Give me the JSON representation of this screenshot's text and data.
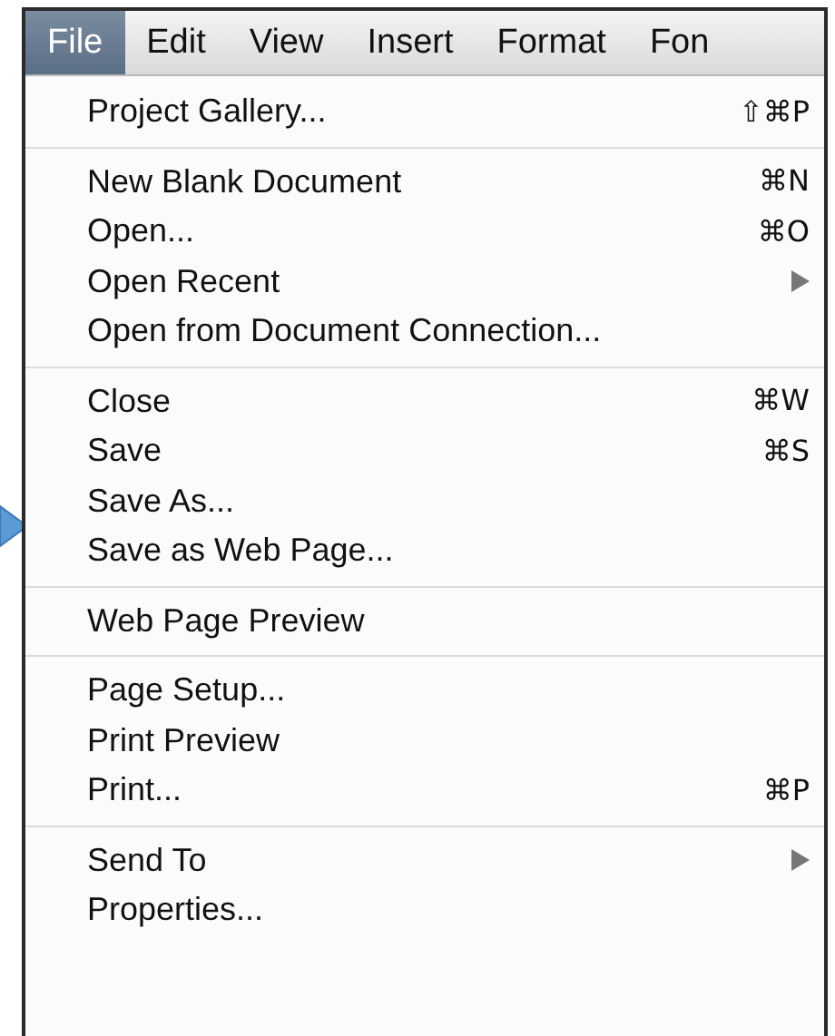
{
  "menu_bar": [
    {
      "label": "File",
      "selected": true
    },
    {
      "label": "Edit",
      "selected": false
    },
    {
      "label": "View",
      "selected": false
    },
    {
      "label": "Insert",
      "selected": false
    },
    {
      "label": "Format",
      "selected": false
    },
    {
      "label": "Fon",
      "selected": false
    }
  ],
  "menu": {
    "groups": [
      {
        "items": [
          {
            "label": "Project Gallery...",
            "shortcut": "⇧⌘P",
            "submenu": false
          }
        ]
      },
      {
        "items": [
          {
            "label": "New Blank Document",
            "shortcut": "⌘N",
            "submenu": false
          },
          {
            "label": "Open...",
            "shortcut": "⌘O",
            "submenu": false
          },
          {
            "label": "Open Recent",
            "submenu": true
          },
          {
            "label": "Open from Document Connection...",
            "submenu": false
          }
        ]
      },
      {
        "items": [
          {
            "label": "Close",
            "shortcut": "⌘W",
            "submenu": false
          },
          {
            "label": "Save",
            "shortcut": "⌘S",
            "submenu": false
          },
          {
            "label": "Save As...",
            "submenu": false
          },
          {
            "label": "Save as Web Page...",
            "submenu": false
          }
        ]
      },
      {
        "items": [
          {
            "label": "Web Page Preview",
            "submenu": false
          }
        ]
      },
      {
        "items": [
          {
            "label": "Page Setup...",
            "submenu": false
          },
          {
            "label": "Print Preview",
            "submenu": false
          },
          {
            "label": "Print...",
            "shortcut": "⌘P",
            "submenu": false
          }
        ]
      },
      {
        "items": [
          {
            "label": "Send To",
            "submenu": true
          },
          {
            "label": "Properties...",
            "submenu": false
          }
        ]
      }
    ]
  }
}
